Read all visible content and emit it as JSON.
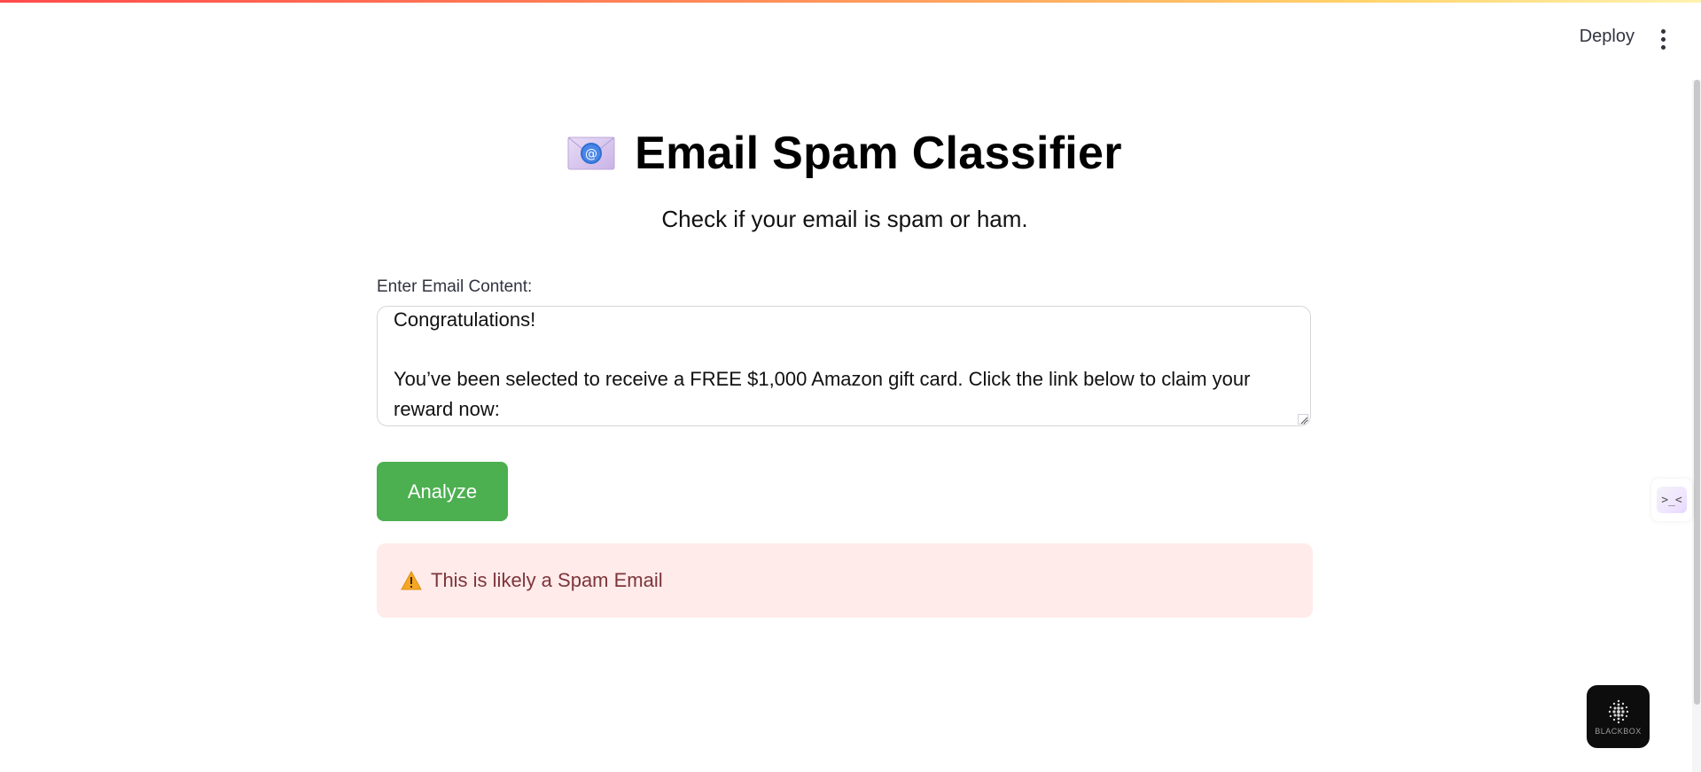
{
  "header": {
    "deploy_label": "Deploy",
    "menu_icon": "vertical-dots-icon"
  },
  "main": {
    "title": "Email Spam Classifier",
    "title_icon": "envelope-at-icon",
    "subtitle": "Check if your email is spam or ham.",
    "input_label": "Enter Email Content:",
    "textarea_value": "Congratulations!\n\nYou’ve been selected to receive a FREE $1,000 Amazon gift card. Click the link below to claim your reward now:",
    "analyze_label": "Analyze",
    "result_text": "This is likely a Spam Email",
    "result_icon": "warning-icon"
  },
  "widgets": {
    "side_widget_glyph": ">_<",
    "blackbox_label": "BLACKBOX"
  },
  "colors": {
    "accent_button": "#4caf50",
    "alert_background": "#ffebea",
    "alert_text": "#7d353b"
  }
}
